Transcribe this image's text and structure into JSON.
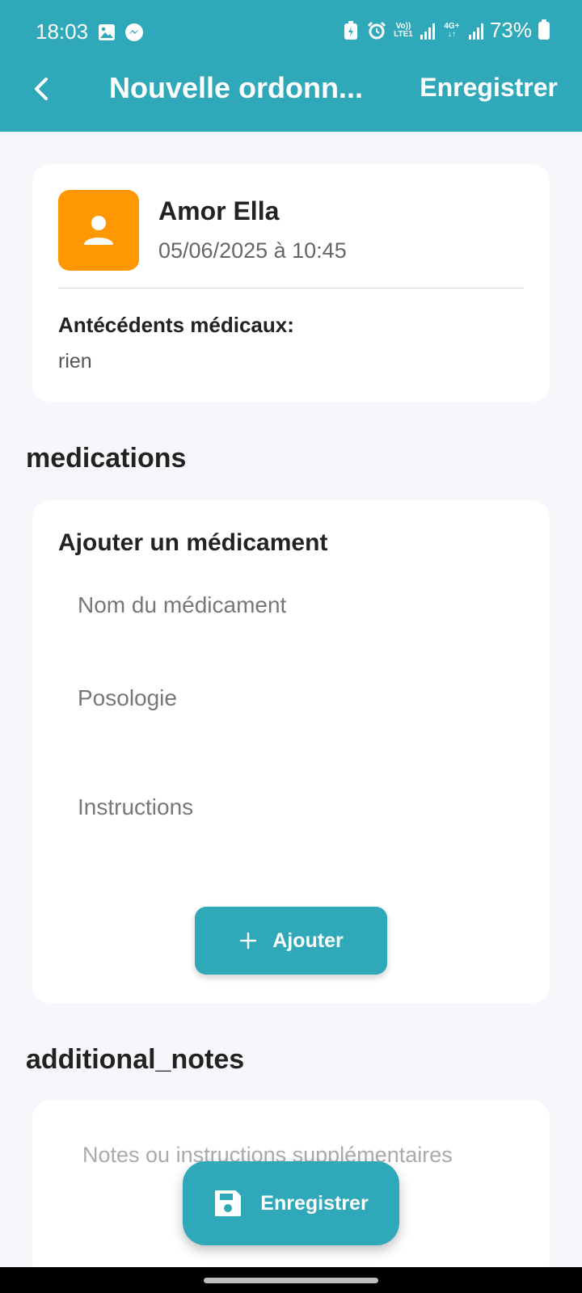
{
  "status_bar": {
    "time": "18:03",
    "left_icons": [
      "image-icon",
      "messenger-icon"
    ],
    "right_icons": [
      "battery-saver-icon",
      "alarm-icon",
      "volte-icon",
      "signal-icon",
      "4g-icon",
      "signal-icon",
      "battery-icon"
    ],
    "volte_label_top": "Vo))",
    "volte_label_bottom": "LTE1",
    "net_label_top": "4G+",
    "net_label_bottom": "↓↑",
    "battery": "73%"
  },
  "app_bar": {
    "title": "Nouvelle ordonn...",
    "save_label": "Enregistrer",
    "back_icon": "chevron-left-icon",
    "color": "#2FA8BA"
  },
  "patient": {
    "name": "Amor Ella",
    "datetime": "05/06/2025 à 10:45",
    "avatar_icon": "person-icon",
    "avatar_color": "#FF9800",
    "history_label": "Antécédents médicaux:",
    "history_value": "rien"
  },
  "medications": {
    "section_title": "medications",
    "card_title": "Ajouter un médicament",
    "name_placeholder": "Nom du médicament",
    "dosage_placeholder": "Posologie",
    "instructions_placeholder": "Instructions",
    "add_label": "Ajouter",
    "add_icon": "plus-icon"
  },
  "notes": {
    "section_title": "additional_notes",
    "placeholder": "Notes ou instructions supplémentaires"
  },
  "fab": {
    "label": "Enregistrer",
    "icon": "save-icon"
  }
}
